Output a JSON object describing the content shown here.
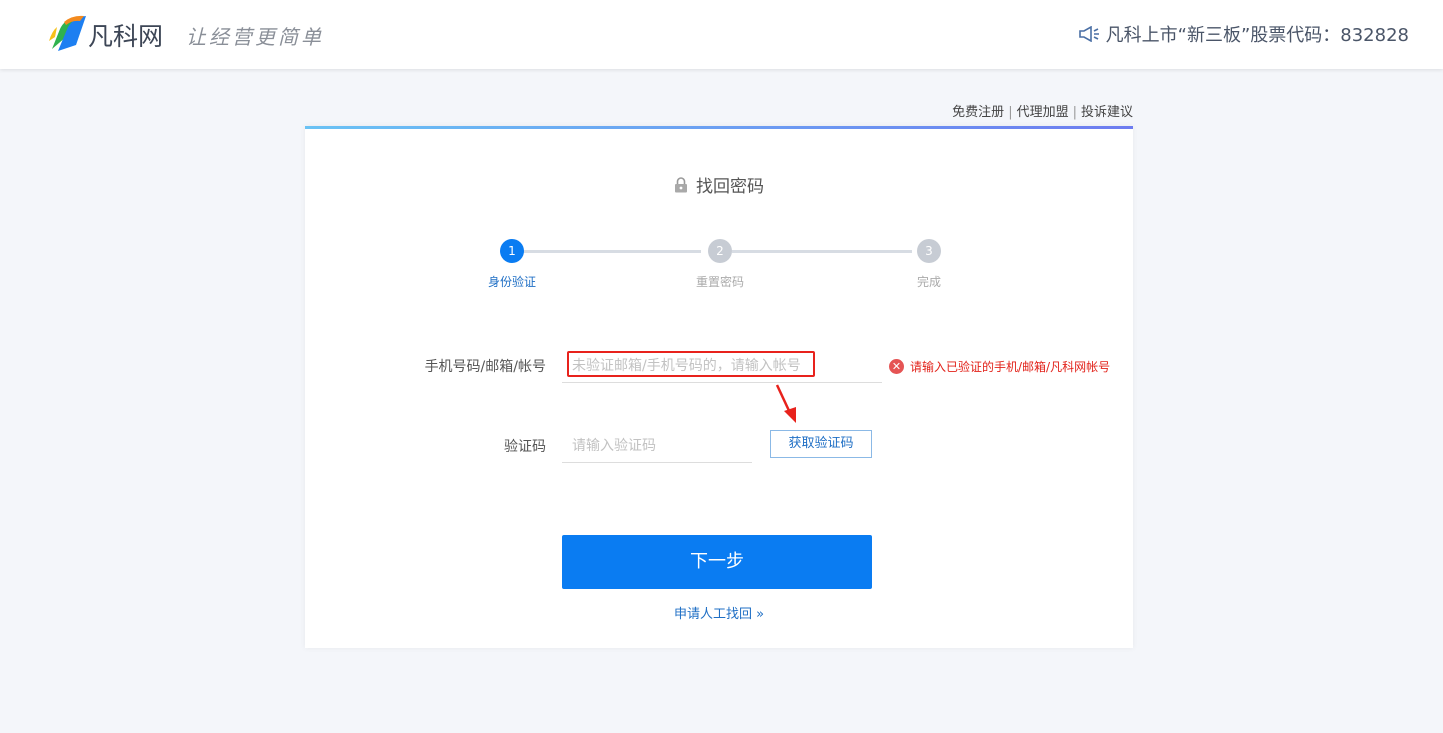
{
  "header": {
    "logo_name": "凡科网",
    "slogan": "让经营更简单",
    "announcement": "凡科上市“新三板”股票代码：832828",
    "logo_colors": {
      "orange": "#f38a1e",
      "green": "#2fb24f",
      "blue": "#1d7ff1"
    }
  },
  "toplinks": {
    "register": "免费注册",
    "agent": "代理加盟",
    "complaint": "投诉建议"
  },
  "card": {
    "title": "找回密码",
    "steps": [
      {
        "number": "1",
        "label": "身份验证",
        "state": "active"
      },
      {
        "number": "2",
        "label": "重置密码",
        "state": "inactive"
      },
      {
        "number": "3",
        "label": "完成",
        "state": "inactive"
      }
    ],
    "account_field": {
      "label": "手机号码/邮箱/帐号",
      "placeholder": "未验证邮箱/手机号码的，请输入帐号",
      "value": ""
    },
    "error_message": "请输入已验证的手机/邮箱/凡科网帐号",
    "code_field": {
      "label": "验证码",
      "placeholder": "请输入验证码",
      "value": ""
    },
    "get_code_button": "获取验证码",
    "next_button": "下一步",
    "manual_link": "申请人工找回 »"
  },
  "colors": {
    "accent": "#0a7cf2",
    "error": "#e2221a",
    "highlight": "#e8221c",
    "background": "#f4f6fa"
  }
}
